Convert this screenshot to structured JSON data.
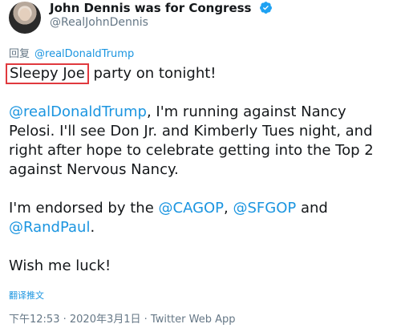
{
  "author": {
    "name": "John Dennis was for Congress",
    "handle": "@RealJohnDennis"
  },
  "reply": {
    "prefix": "回复",
    "mention": "@realDonaldTrump"
  },
  "tweet": {
    "highlighted": "Sleepy Joe",
    "line1_rest": " party on tonight!",
    "p2": {
      "mention": "@realDonaldTrump",
      "l1_rest": ", I'm running against Nancy",
      "l2": "Pelosi. I'll see Don Jr. and Kimberly Tues night, and",
      "l3": "right after hope to celebrate getting into the Top 2",
      "l4": "against Nervous Nancy."
    },
    "p3": {
      "l1_text": "I'm endorsed by the ",
      "m1": "@CAGOP",
      "comma": ", ",
      "m2": "@SFGOP",
      "and": " and",
      "m3": "@RandPaul",
      "period": "."
    },
    "p4": "Wish me luck!"
  },
  "translate_label": "翻译推文",
  "meta": {
    "time": "下午12:53",
    "sep": " · ",
    "date": "2020年3月1日",
    "sep2": " · ",
    "source": "Twitter Web App"
  },
  "colors": {
    "accent": "#1b95e0",
    "highlight_border": "#e0393e",
    "secondary_text": "#657786"
  }
}
